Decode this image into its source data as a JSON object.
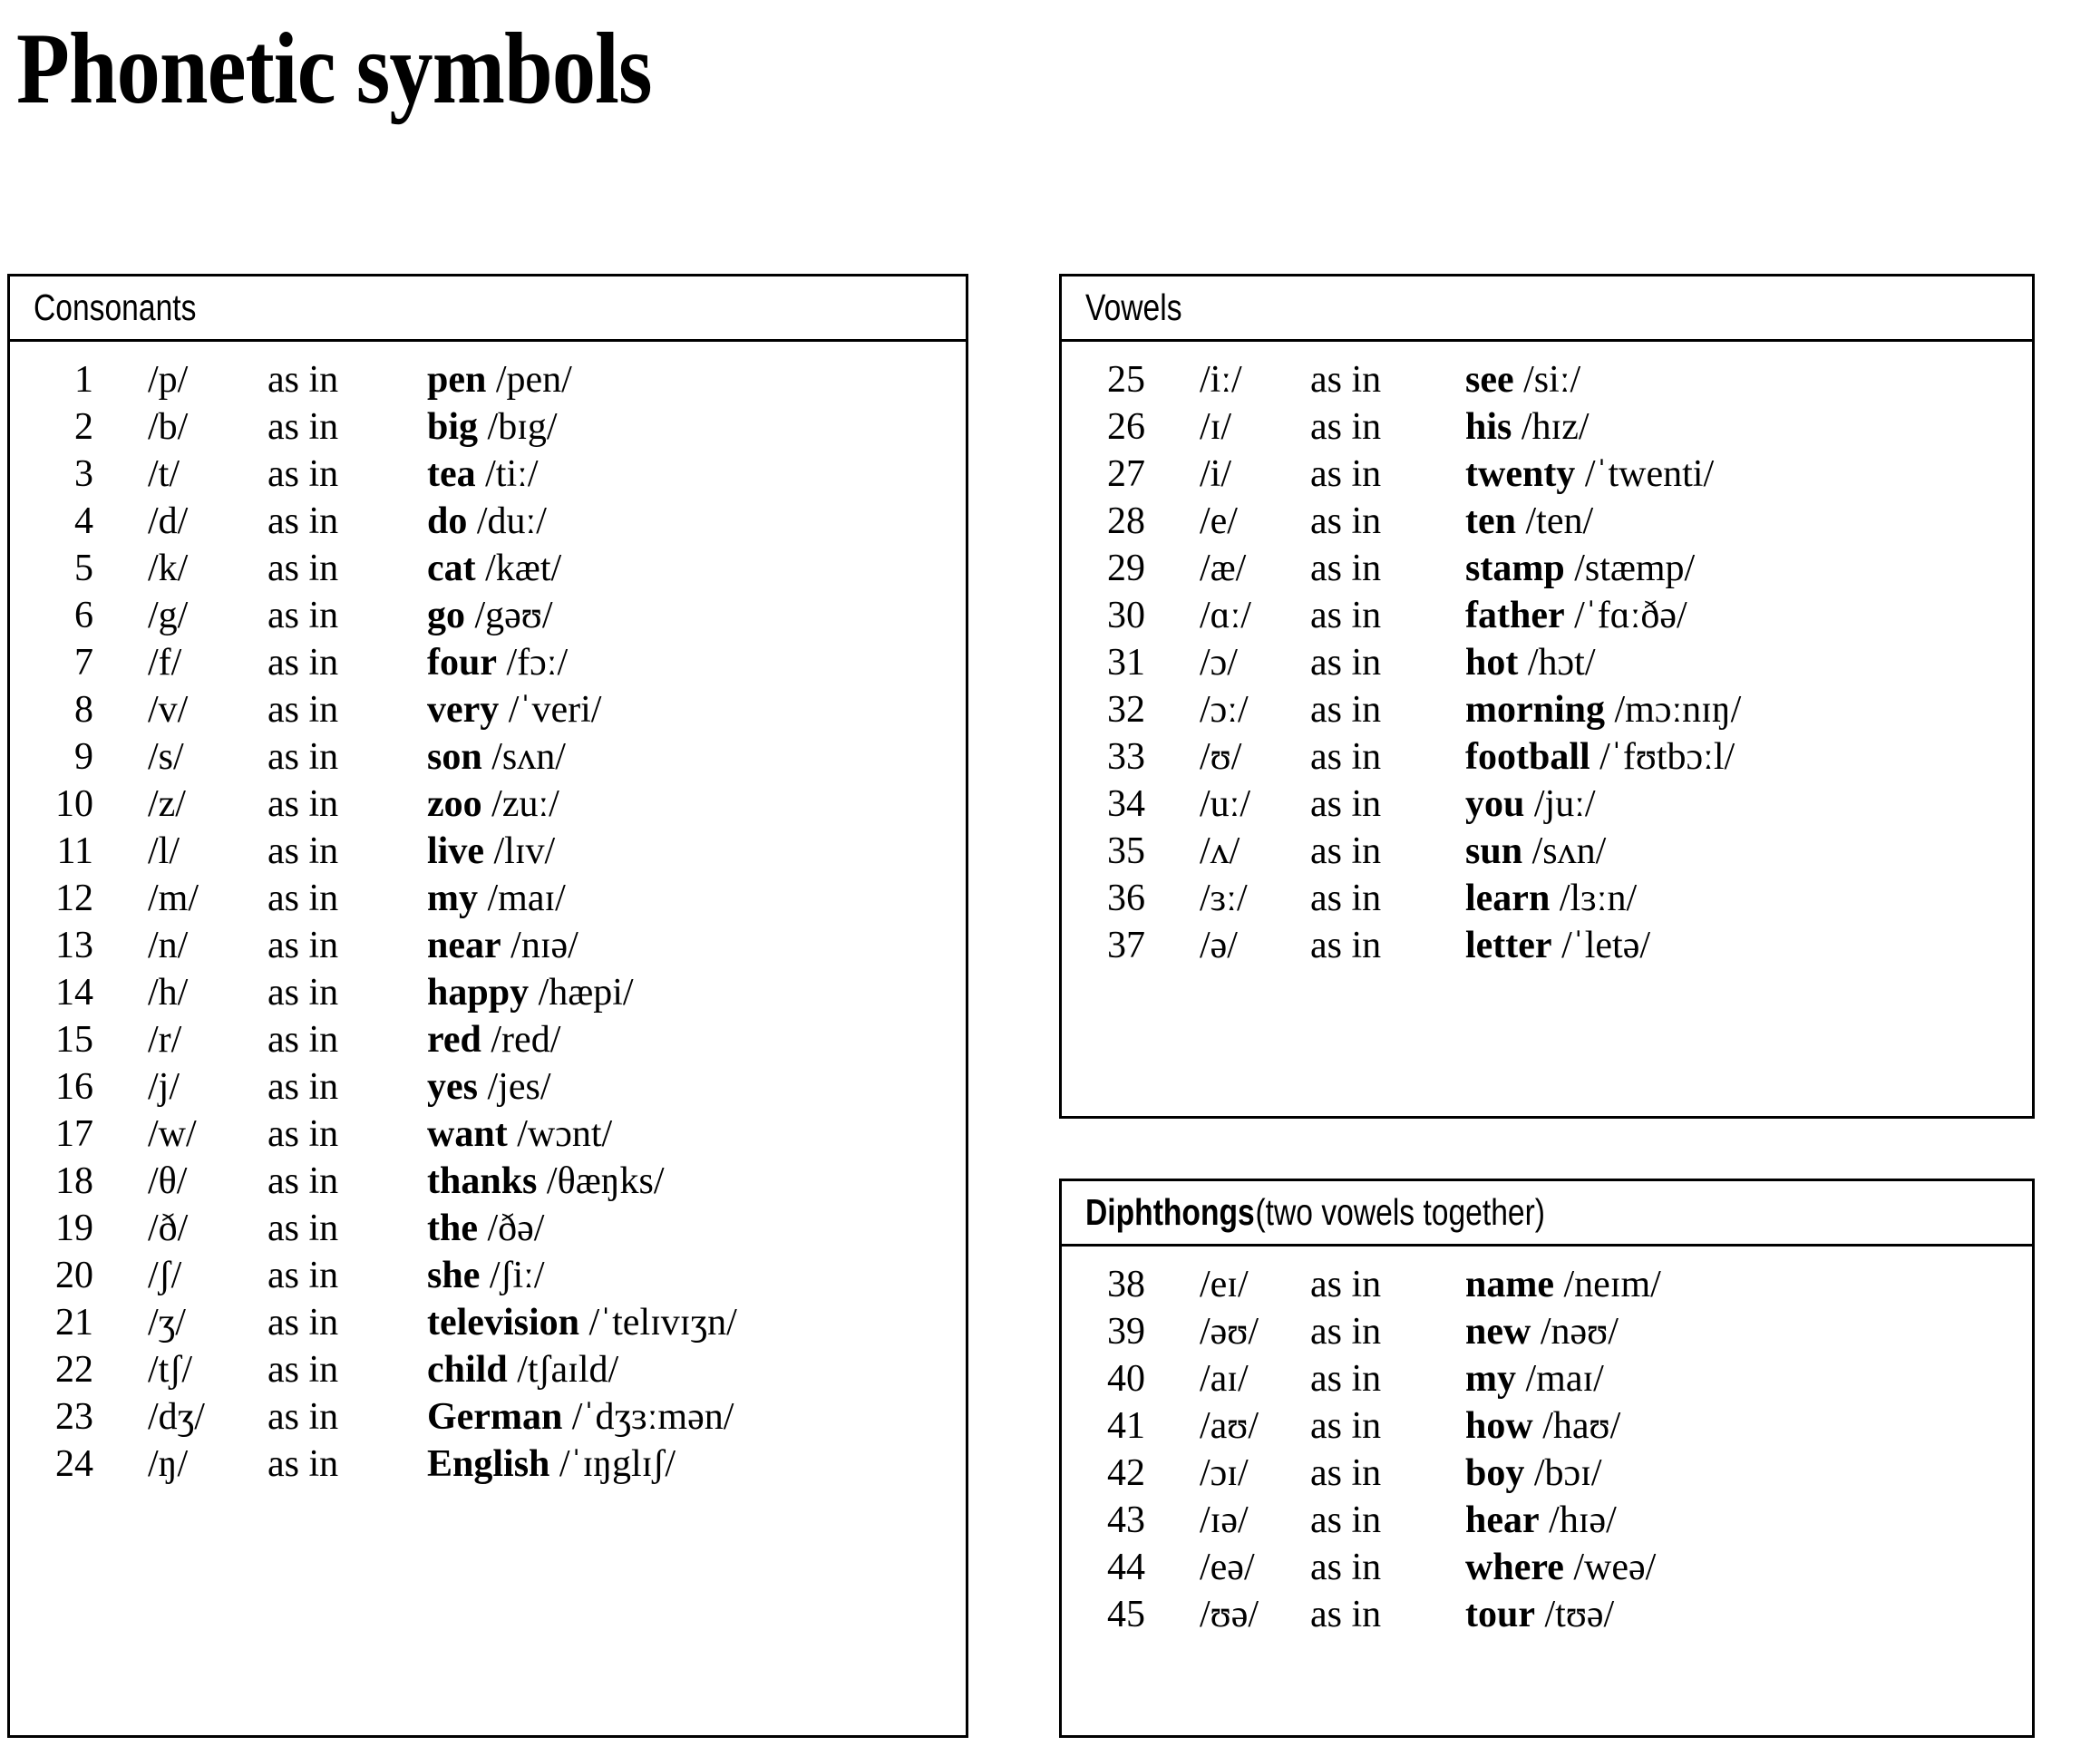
{
  "title": "Phonetic symbols",
  "as_in_label": "as in",
  "sections": [
    {
      "id": "consonants",
      "header": "Consonants",
      "subtitle": "",
      "rows": [
        {
          "num": "1",
          "symbol": "/p/",
          "word": "pen",
          "ipa": "/pen/"
        },
        {
          "num": "2",
          "symbol": "/b/",
          "word": "big",
          "ipa": "/bɪg/"
        },
        {
          "num": "3",
          "symbol": "/t/",
          "word": "tea",
          "ipa": "/tiː/"
        },
        {
          "num": "4",
          "symbol": "/d/",
          "word": "do",
          "ipa": "/duː/"
        },
        {
          "num": "5",
          "symbol": "/k/",
          "word": "cat",
          "ipa": "/kæt/"
        },
        {
          "num": "6",
          "symbol": "/g/",
          "word": "go",
          "ipa": "/gəʊ/"
        },
        {
          "num": "7",
          "symbol": "/f/",
          "word": "four",
          "ipa": "/fɔː/"
        },
        {
          "num": "8",
          "symbol": "/v/",
          "word": "very",
          "ipa": "/ˈveri/"
        },
        {
          "num": "9",
          "symbol": "/s/",
          "word": "son",
          "ipa": "/sʌn/"
        },
        {
          "num": "10",
          "symbol": "/z/",
          "word": "zoo",
          "ipa": "/zuː/"
        },
        {
          "num": "11",
          "symbol": "/l/",
          "word": "live",
          "ipa": "/lɪv/"
        },
        {
          "num": "12",
          "symbol": "/m/",
          "word": "my",
          "ipa": "/maɪ/"
        },
        {
          "num": "13",
          "symbol": "/n/",
          "word": "near",
          "ipa": "/nɪə/"
        },
        {
          "num": "14",
          "symbol": "/h/",
          "word": "happy",
          "ipa": "/hæpi/"
        },
        {
          "num": "15",
          "symbol": "/r/",
          "word": "red",
          "ipa": "/red/"
        },
        {
          "num": "16",
          "symbol": "/j/",
          "word": "yes",
          "ipa": "/jes/"
        },
        {
          "num": "17",
          "symbol": "/w/",
          "word": "want",
          "ipa": "/wɔnt/"
        },
        {
          "num": "18",
          "symbol": "/θ/",
          "word": "thanks",
          "ipa": "/θæŋks/"
        },
        {
          "num": "19",
          "symbol": "/ð/",
          "word": "the",
          "ipa": "/ðə/"
        },
        {
          "num": "20",
          "symbol": "/ʃ/",
          "word": "she",
          "ipa": "/ʃiː/"
        },
        {
          "num": "21",
          "symbol": "/ʒ/",
          "word": "television",
          "ipa": "/ˈtelɪvɪʒn/"
        },
        {
          "num": "22",
          "symbol": "/tʃ/",
          "word": "child",
          "ipa": "/tʃaɪld/"
        },
        {
          "num": "23",
          "symbol": "/dʒ/",
          "word": "German",
          "ipa": "/ˈdʒɜːmən/"
        },
        {
          "num": "24",
          "symbol": "/ŋ/",
          "word": "English",
          "ipa": "/ˈɪŋglɪʃ/"
        }
      ]
    },
    {
      "id": "vowels",
      "header": "Vowels",
      "subtitle": "",
      "rows": [
        {
          "num": "25",
          "symbol": "/iː/",
          "word": "see",
          "ipa": "/siː/"
        },
        {
          "num": "26",
          "symbol": "/ɪ/",
          "word": "his",
          "ipa": "/hɪz/"
        },
        {
          "num": "27",
          "symbol": "/i/",
          "word": "twenty",
          "ipa": "/ˈtwenti/"
        },
        {
          "num": "28",
          "symbol": "/e/",
          "word": "ten",
          "ipa": "/ten/"
        },
        {
          "num": "29",
          "symbol": "/æ/",
          "word": "stamp",
          "ipa": "/stæmp/"
        },
        {
          "num": "30",
          "symbol": "/ɑː/",
          "word": "father",
          "ipa": "/ˈfɑːðə/"
        },
        {
          "num": "31",
          "symbol": "/ɔ/",
          "word": "hot",
          "ipa": "/hɔt/"
        },
        {
          "num": "32",
          "symbol": "/ɔː/",
          "word": "morning",
          "ipa": "/mɔːnɪŋ/"
        },
        {
          "num": "33",
          "symbol": "/ʊ/",
          "word": "football",
          "ipa": "/ˈfʊtbɔːl/"
        },
        {
          "num": "34",
          "symbol": "/uː/",
          "word": "you",
          "ipa": "/juː/"
        },
        {
          "num": "35",
          "symbol": "/ʌ/",
          "word": "sun",
          "ipa": "/sʌn/"
        },
        {
          "num": "36",
          "symbol": "/ɜː/",
          "word": "learn",
          "ipa": "/lɜːn/"
        },
        {
          "num": "37",
          "symbol": "/ə/",
          "word": "letter",
          "ipa": "/ˈletə/"
        }
      ]
    },
    {
      "id": "diphthongs",
      "header": "Diphthongs",
      "subtitle": "(two vowels together)",
      "rows": [
        {
          "num": "38",
          "symbol": "/eɪ/",
          "word": "name",
          "ipa": "/neɪm/"
        },
        {
          "num": "39",
          "symbol": "/əʊ/",
          "word": "new",
          "ipa": "/nəʊ/"
        },
        {
          "num": "40",
          "symbol": "/aɪ/",
          "word": "my",
          "ipa": "/maɪ/"
        },
        {
          "num": "41",
          "symbol": "/aʊ/",
          "word": "how",
          "ipa": "/haʊ/"
        },
        {
          "num": "42",
          "symbol": "/ɔɪ/",
          "word": "boy",
          "ipa": "/bɔɪ/"
        },
        {
          "num": "43",
          "symbol": "/ɪə/",
          "word": "hear",
          "ipa": "/hɪə/"
        },
        {
          "num": "44",
          "symbol": "/eə/",
          "word": "where",
          "ipa": "/weə/"
        },
        {
          "num": "45",
          "symbol": "/ʊə/",
          "word": "tour",
          "ipa": "/tʊə/"
        }
      ]
    }
  ]
}
